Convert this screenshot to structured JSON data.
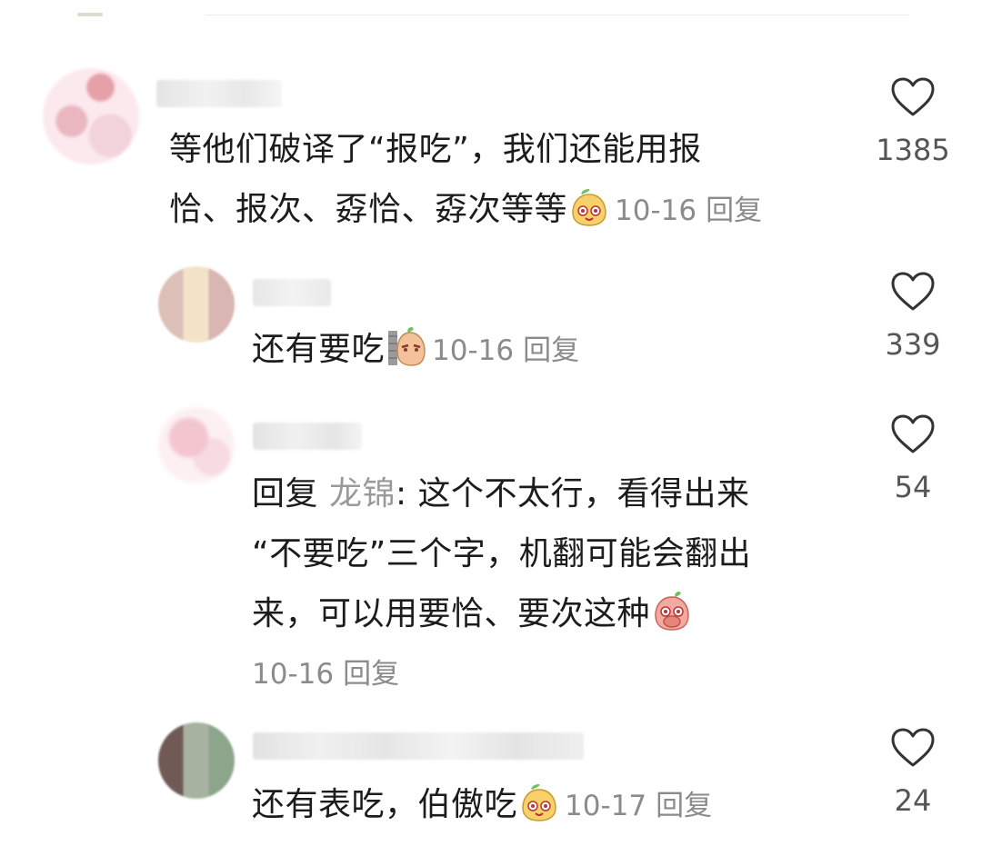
{
  "comments": [
    {
      "text_line1": "等他们破译了“报吃”，我们还能用报",
      "text_line2": "恰、报次、孬恰、孬次等等",
      "date": "10-16",
      "reply_label": "回复",
      "likes": "1385",
      "emoji": "smiling-peach-emoji"
    },
    {
      "text_line1": "还有要吃",
      "date": "10-16",
      "reply_label": "回复",
      "likes": "339",
      "emoji": "peeking-wall-emoji"
    },
    {
      "reply_prefix": "回复",
      "mention": "龙锦",
      "text_line1": ": 这个不太行，看得出来",
      "text_line2": "“不要吃”三个字，机翻可能会翻出",
      "text_line3": "来，可以用要恰、要次这种",
      "date": "10-16",
      "reply_label": "回复",
      "likes": "54",
      "emoji": "covering-mouth-peach-emoji"
    },
    {
      "text_line1": "还有表吃，伯傲吃",
      "date": "10-17",
      "reply_label": "回复",
      "likes": "24",
      "emoji": "smiling-peach-emoji"
    }
  ],
  "colors": {
    "text": "#1c1c1c",
    "meta": "#8b8b8b",
    "mention": "#9a9a9a",
    "heart_outline": "#333333"
  }
}
